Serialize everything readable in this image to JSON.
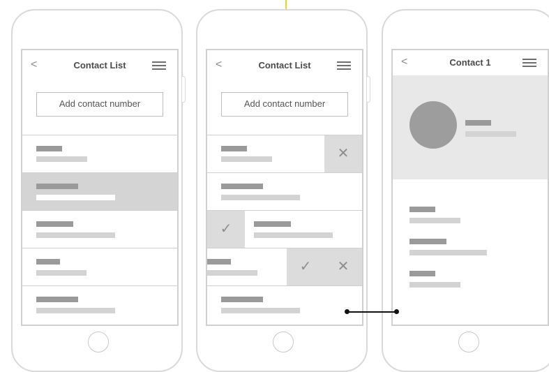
{
  "phone1": {
    "nav": {
      "back": "<",
      "title": "Contact List",
      "menu_icon": "hamburger-menu-icon"
    },
    "add_placeholder": "Add contact number"
  },
  "phone2": {
    "nav": {
      "back": "<",
      "title": "Contact List",
      "menu_icon": "hamburger-menu-icon"
    },
    "add_placeholder": "Add contact number",
    "actions": {
      "delete": "✕",
      "confirm": "✓"
    }
  },
  "phone3": {
    "nav": {
      "back": "<",
      "title": "Contact 1",
      "menu_icon": "hamburger-menu-icon"
    }
  },
  "colors": {
    "accent": "#f0d21c",
    "selected_row": "#d4d4d4",
    "profile_header": "#e8e8e8"
  }
}
